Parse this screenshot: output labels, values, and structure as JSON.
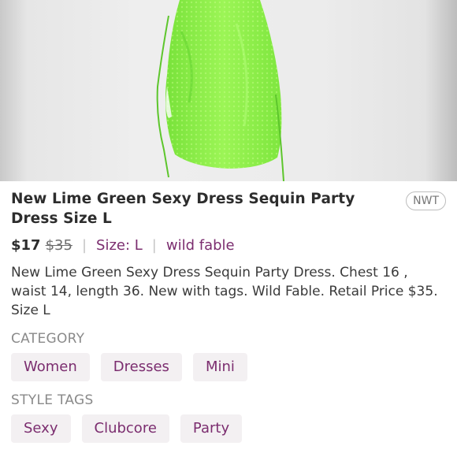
{
  "listing": {
    "image_alt": "Lime green sequin ruched party dress",
    "title": "New Lime Green Sexy Dress Sequin Party Dress Size L",
    "condition_badge": "NWT",
    "price": "$17",
    "original_price": "$35",
    "size": "Size: L",
    "brand": "wild fable",
    "separator": "|",
    "description": "New Lime Green Sexy Dress Sequin Party Dress.  Chest 16 , waist 14, length 36. New with tags. Wild Fable. Retail Price $35.  Size L"
  },
  "category": {
    "label": "CATEGORY",
    "items": [
      "Women",
      "Dresses",
      "Mini"
    ]
  },
  "style_tags": {
    "label": "STYLE TAGS",
    "items": [
      "Sexy",
      "Clubcore",
      "Party"
    ]
  },
  "colors": {
    "accent": "#7b2d6f",
    "chip_bg": "#f3f0f2",
    "dress": "#8ef04a"
  }
}
